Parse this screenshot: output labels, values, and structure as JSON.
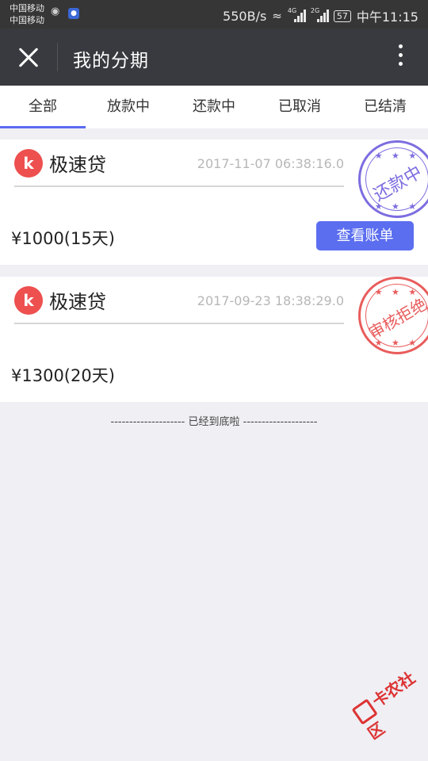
{
  "status_bar": {
    "carrier1": "中国移动",
    "carrier2": "中国移动",
    "speed": "550B/s",
    "sig1_label": "4G",
    "sig2_label": "2G",
    "battery": "57",
    "time": "中午11:15"
  },
  "header": {
    "title": "我的分期"
  },
  "tabs": [
    "全部",
    "放款中",
    "还款中",
    "已取消",
    "已结清"
  ],
  "cards": [
    {
      "name": "极速贷",
      "time": "2017-11-07 06:38:16.0",
      "amount": "¥1000(15天)",
      "button": "查看账单",
      "stamp": "还款中"
    },
    {
      "name": "极速贷",
      "time": "2017-09-23 18:38:29.0",
      "amount": "¥1300(20天)",
      "stamp": "审核拒绝"
    }
  ],
  "bottom_tip": "-------------------- 已经到底啦 --------------------",
  "watermark": "卡农社区",
  "colors": {
    "accent": "#5b6cf0",
    "header_bg": "#393a3f",
    "stamp_blue": "#7c6de0",
    "stamp_red": "#e95c5c",
    "logo_red": "#ee4f4f"
  }
}
